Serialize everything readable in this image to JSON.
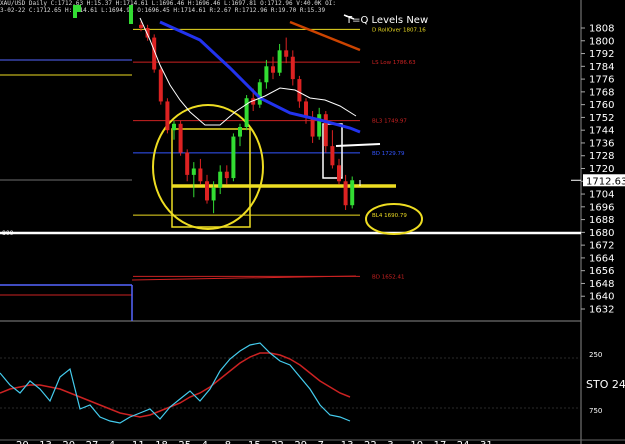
{
  "header": {
    "symbol": "XAU/USD Daily",
    "row1": "XAU/USD Daily  C:1712.63  H:15.37  H:1714.61  L:1696.46  H:1696.46  L:1697.81  O:1712.96  V:40.0K  OI:",
    "row2": "3-02-22  C:1712.65  H:1714.61  L:1694.91  O:1696.45  H:1714.61  R:2.67  R:1712.96  R:19.70  R:15.39"
  },
  "title": "T=Q Levels New",
  "colors": {
    "background": "#000000",
    "up_candle": "#33dd33",
    "down_candle": "#dd2222",
    "ma_blue": "#2233ee",
    "ma_orange": "#cc4400",
    "ma_white": "#ffffff",
    "sto_k": "#44ccee",
    "sto_d": "#cc2222",
    "yellow": "#eedd22"
  },
  "levels": [
    {
      "label": "D RollOver 1807.16",
      "value": 1807.16,
      "color": "#eedd22"
    },
    {
      "label": "LS Low 1786.63",
      "value": 1786.63,
      "color": "#cc2222"
    },
    {
      "label": "BL3 1749.97",
      "value": 1749.97,
      "color": "#cc2222"
    },
    {
      "label": "BD 1729.79",
      "value": 1729.79,
      "color": "#3355ff"
    },
    {
      "label": "BL4 1690.79",
      "value": 1690.79,
      "color": "#eedd22"
    },
    {
      "label": "BD 1652.41",
      "value": 1652.41,
      "color": "#cc2222"
    }
  ],
  "other_labels": {
    "left_value": "800",
    "sto_label": "STO 24,",
    "sto_tick_upper": "250",
    "sto_tick_lower": "750"
  },
  "chart_data": [
    {
      "type": "line",
      "title": "T=Q Levels New",
      "price_axis": {
        "ticks": [
          1808,
          1800,
          1792,
          1784,
          1776,
          1768,
          1760,
          1752,
          1744,
          1736,
          1728,
          1720,
          1712,
          1704,
          1696,
          1688,
          1680,
          1672,
          1664,
          1656,
          1648,
          1640,
          1632
        ],
        "current_price": "1712.63",
        "ylim": [
          1628,
          1816
        ]
      },
      "x_axis": {
        "tick_labels": [
          "20",
          "13",
          "20",
          "27",
          "4",
          "11",
          "18",
          "25",
          "4",
          "8",
          "15",
          "22",
          "29",
          "7",
          "13",
          "22",
          "3",
          "10",
          "17",
          "24",
          "31"
        ]
      },
      "candles": [
        {
          "o": 1810,
          "h": 1812,
          "l": 1806,
          "c": 1808
        },
        {
          "o": 1808,
          "h": 1810,
          "l": 1800,
          "c": 1802
        },
        {
          "o": 1802,
          "h": 1804,
          "l": 1780,
          "c": 1782
        },
        {
          "o": 1782,
          "h": 1784,
          "l": 1760,
          "c": 1762
        },
        {
          "o": 1762,
          "h": 1764,
          "l": 1742,
          "c": 1744
        },
        {
          "o": 1744,
          "h": 1750,
          "l": 1738,
          "c": 1748
        },
        {
          "o": 1748,
          "h": 1750,
          "l": 1728,
          "c": 1730
        },
        {
          "o": 1730,
          "h": 1732,
          "l": 1712,
          "c": 1716
        },
        {
          "o": 1716,
          "h": 1724,
          "l": 1702,
          "c": 1720
        },
        {
          "o": 1720,
          "h": 1726,
          "l": 1710,
          "c": 1712
        },
        {
          "o": 1712,
          "h": 1716,
          "l": 1698,
          "c": 1700
        },
        {
          "o": 1700,
          "h": 1712,
          "l": 1692,
          "c": 1708
        },
        {
          "o": 1708,
          "h": 1722,
          "l": 1704,
          "c": 1718
        },
        {
          "o": 1718,
          "h": 1722,
          "l": 1710,
          "c": 1714
        },
        {
          "o": 1714,
          "h": 1742,
          "l": 1712,
          "c": 1740
        },
        {
          "o": 1740,
          "h": 1748,
          "l": 1734,
          "c": 1746
        },
        {
          "o": 1746,
          "h": 1766,
          "l": 1744,
          "c": 1764
        },
        {
          "o": 1764,
          "h": 1770,
          "l": 1756,
          "c": 1760
        },
        {
          "o": 1760,
          "h": 1776,
          "l": 1758,
          "c": 1774
        },
        {
          "o": 1774,
          "h": 1788,
          "l": 1770,
          "c": 1784
        },
        {
          "o": 1784,
          "h": 1790,
          "l": 1776,
          "c": 1780
        },
        {
          "o": 1780,
          "h": 1798,
          "l": 1778,
          "c": 1794
        },
        {
          "o": 1794,
          "h": 1802,
          "l": 1786,
          "c": 1790
        },
        {
          "o": 1790,
          "h": 1794,
          "l": 1772,
          "c": 1776
        },
        {
          "o": 1776,
          "h": 1778,
          "l": 1758,
          "c": 1762
        },
        {
          "o": 1762,
          "h": 1764,
          "l": 1748,
          "c": 1752
        },
        {
          "o": 1752,
          "h": 1756,
          "l": 1736,
          "c": 1740
        },
        {
          "o": 1740,
          "h": 1758,
          "l": 1738,
          "c": 1754
        },
        {
          "o": 1754,
          "h": 1756,
          "l": 1730,
          "c": 1734
        },
        {
          "o": 1734,
          "h": 1744,
          "l": 1720,
          "c": 1722
        },
        {
          "o": 1722,
          "h": 1726,
          "l": 1710,
          "c": 1712
        },
        {
          "o": 1712,
          "h": 1716,
          "l": 1694,
          "c": 1697
        },
        {
          "o": 1697,
          "h": 1715,
          "l": 1695,
          "c": 1712.63
        }
      ],
      "sto_k": [
        60,
        48,
        40,
        52,
        44,
        32,
        56,
        64,
        24,
        28,
        16,
        12,
        10,
        16,
        20,
        24,
        14,
        26,
        34,
        42,
        32,
        44,
        62,
        74,
        82,
        88,
        90,
        80,
        72,
        68,
        56,
        44,
        28,
        18,
        16,
        12
      ],
      "sto_d": [
        40,
        44,
        46,
        48,
        48,
        46,
        44,
        40,
        36,
        32,
        28,
        24,
        20,
        18,
        16,
        18,
        22,
        26,
        30,
        36,
        40,
        46,
        54,
        62,
        70,
        76,
        80,
        80,
        78,
        74,
        68,
        60,
        52,
        46,
        40,
        36
      ]
    }
  ]
}
